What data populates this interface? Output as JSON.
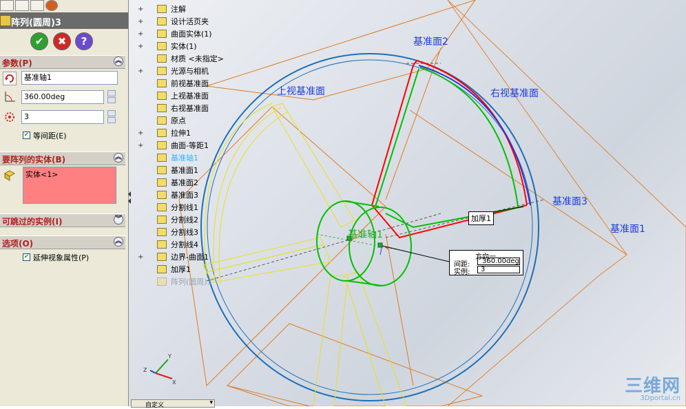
{
  "property_manager": {
    "title": "阵列(圆周)3",
    "ok_button": "✔",
    "cancel_button": "✖",
    "help_button": "?",
    "sections": {
      "params": {
        "header": "参数(P)",
        "axis_value": "基准轴1",
        "angle_value": "360.00deg",
        "count_value": "3",
        "equal_spacing_label": "等间距(E)",
        "equal_spacing_checked": true
      },
      "bodies": {
        "header": "要阵列的实体(B)",
        "selected": "实体<1>"
      },
      "skip": {
        "header": "可跳过的实例(I)"
      },
      "options": {
        "header": "选项(O)",
        "propagate_label": "延伸视象属性(P)",
        "propagate_checked": true
      }
    }
  },
  "tree": {
    "items": [
      {
        "label": "注解",
        "expand": "+",
        "icon": "annotation-icon"
      },
      {
        "label": "设计活页夹",
        "expand": "+",
        "icon": "design-binder-icon"
      },
      {
        "label": "曲面实体(1)",
        "expand": "+",
        "icon": "surface-bodies-icon"
      },
      {
        "label": "实体(1)",
        "expand": "+",
        "icon": "solid-bodies-icon"
      },
      {
        "label": "材质 <未指定>",
        "expand": "",
        "icon": "material-icon"
      },
      {
        "label": "光源与相机",
        "expand": "+",
        "icon": "lights-icon"
      },
      {
        "label": "前视基准面",
        "expand": "",
        "icon": "plane-icon"
      },
      {
        "label": "上视基准面",
        "expand": "",
        "icon": "plane-icon"
      },
      {
        "label": "右视基准面",
        "expand": "",
        "icon": "plane-icon"
      },
      {
        "label": "原点",
        "expand": "",
        "icon": "origin-icon"
      },
      {
        "label": "拉伸1",
        "expand": "+",
        "icon": "extrude-icon"
      },
      {
        "label": "曲面-等距1",
        "expand": "+",
        "icon": "offset-surface-icon"
      },
      {
        "label": "基准轴1",
        "expand": "",
        "icon": "axis-icon",
        "highlight": true
      },
      {
        "label": "基准面1",
        "expand": "",
        "icon": "plane-icon"
      },
      {
        "label": "基准面2",
        "expand": "",
        "icon": "plane-icon"
      },
      {
        "label": "基准面3",
        "expand": "",
        "icon": "plane-icon"
      },
      {
        "label": "分割线1",
        "expand": "",
        "icon": "split-line-icon"
      },
      {
        "label": "分割线2",
        "expand": "",
        "icon": "split-line-icon"
      },
      {
        "label": "分割线3",
        "expand": "",
        "icon": "split-line-icon"
      },
      {
        "label": "分割线4",
        "expand": "",
        "icon": "split-line-icon"
      },
      {
        "label": "边界-曲面1",
        "expand": "+",
        "icon": "boundary-surface-icon"
      },
      {
        "label": "加厚1",
        "expand": "",
        "icon": "thicken-icon"
      },
      {
        "label": "阵列(圆周)3",
        "expand": "",
        "icon": "circular-pattern-icon",
        "ghost": true
      }
    ]
  },
  "viewport": {
    "plane_labels": {
      "plane2": "基准面2",
      "top_plane": "上视基准面",
      "right_plane": "右视基准面",
      "plane3": "基准面3",
      "plane1": "基准面1",
      "axis": "基准轴1"
    },
    "thicken_tag": "加厚1",
    "callout": {
      "title": "方向一",
      "spacing_label": "间距:",
      "spacing_value": "360.00deg",
      "count_label": "实例:",
      "count_value": "3"
    },
    "watermark_big": "三维网",
    "watermark_small": "3Dportal.cn",
    "bottom_combo": "自定义"
  },
  "colors": {
    "plane_label": "#1b3bd6",
    "pink_selection": "#ff8080",
    "title_bar": "#6b6b6b"
  }
}
